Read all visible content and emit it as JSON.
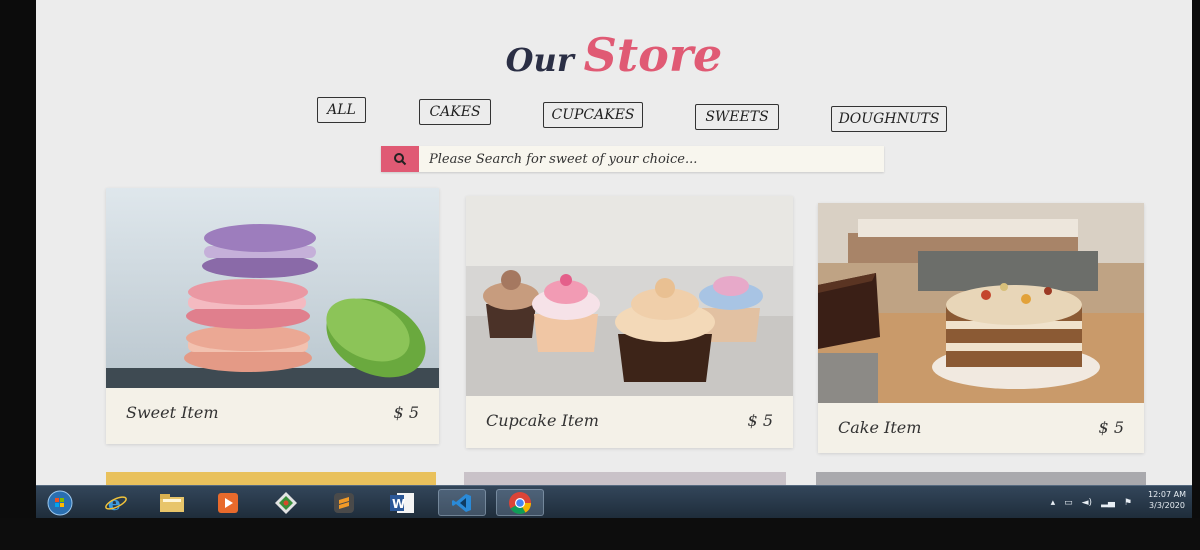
{
  "header": {
    "title_part1": "Our",
    "title_part2": "Store"
  },
  "filters": [
    "ALL",
    "CAKES",
    "CUPCAKES",
    "SWEETS",
    "DOUGHNUTS"
  ],
  "search": {
    "placeholder": "Please Search for sweet of your choice..."
  },
  "products": [
    {
      "name": "Sweet Item",
      "price": "$ 5"
    },
    {
      "name": "Cupcake Item",
      "price": "$ 5"
    },
    {
      "name": "Cake Item",
      "price": "$ 5"
    }
  ],
  "taskbar": {
    "apps": [
      "start-orb",
      "internet-explorer",
      "file-explorer",
      "media-player",
      "git",
      "sublime-text",
      "word",
      "visual-studio-code",
      "chrome"
    ],
    "clock_time": "12:07 AM",
    "clock_date": "3/3/2020"
  },
  "colors": {
    "accent": "#e05a74",
    "title_dark": "#2b2f45",
    "screen_bg": "#ececec",
    "card_bg": "#f4f1e8"
  }
}
